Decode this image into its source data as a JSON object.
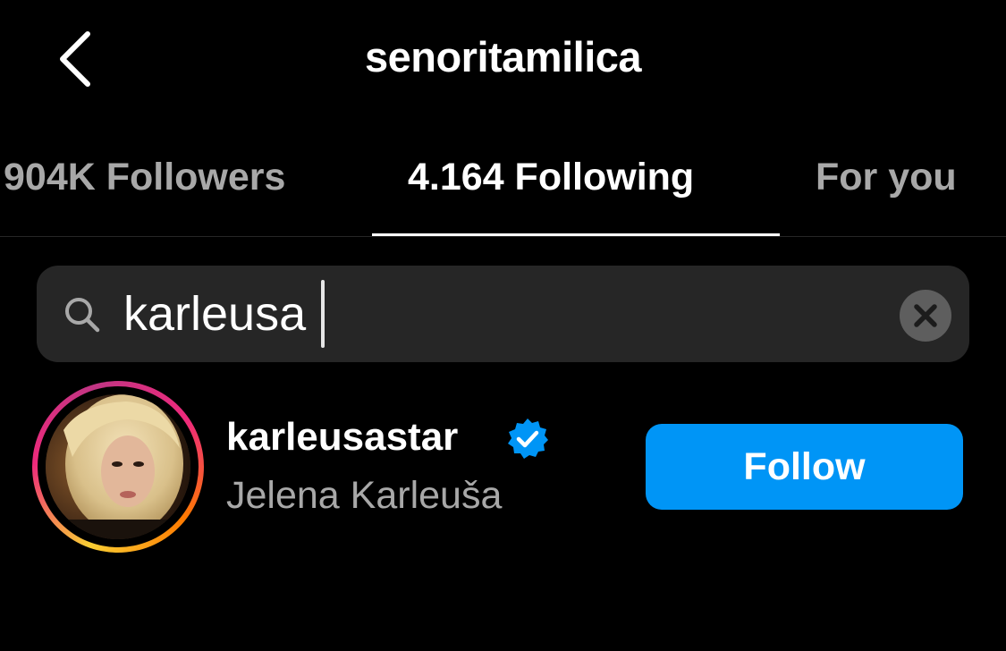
{
  "header": {
    "title": "senoritamilica",
    "back_icon": "chevron-left-icon"
  },
  "tabs": [
    {
      "label": "904K Followers",
      "active": false
    },
    {
      "label": "4.164 Following",
      "active": true
    },
    {
      "label": "For you",
      "active": false
    }
  ],
  "search": {
    "value": "karleusa",
    "search_icon": "search-icon",
    "clear_icon": "clear-icon"
  },
  "results": [
    {
      "username": "karleusastar",
      "full_name": "Jelena Karleuša",
      "verified": true,
      "follow_label": "Follow"
    }
  ],
  "colors": {
    "background": "#000000",
    "search_bg": "#262626",
    "inactive_text": "#a8a8a8",
    "follow_button": "#0095f6",
    "verified_badge": "#0095f6"
  }
}
